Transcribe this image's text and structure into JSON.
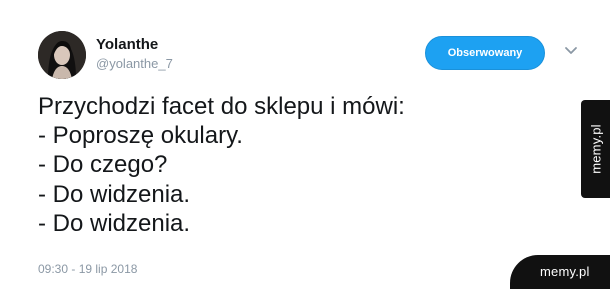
{
  "profile": {
    "display_name": "Yolanthe",
    "handle": "@yolanthe_7",
    "avatar_icon": "profile-photo"
  },
  "follow_button": {
    "label": "Obserwowany",
    "color": "#1da1f2"
  },
  "menu_icon": "chevron-down-icon",
  "tweet": {
    "lines": [
      "Przychodzi facet do sklepu i mówi:",
      "- Poproszę okulary.",
      "- Do czego?",
      "- Do widzenia.",
      "- Do widzenia."
    ],
    "timestamp": "09:30 - 19 lip 2018"
  },
  "watermarks": {
    "side": "memy.pl",
    "corner": "memy.pl"
  }
}
